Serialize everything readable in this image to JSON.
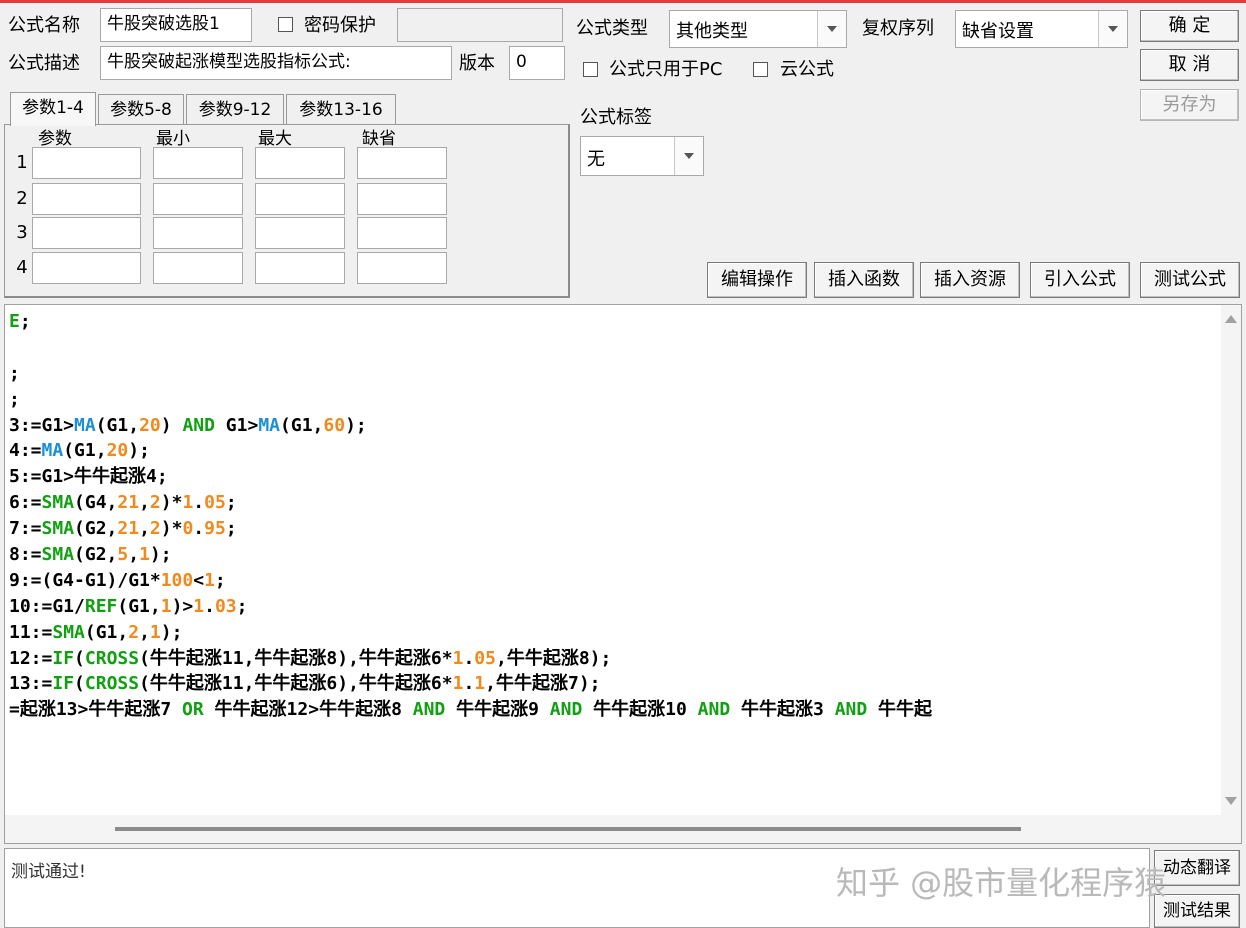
{
  "form": {
    "name_label": "公式名称",
    "name_value": "牛股突破选股1",
    "password_label": "密码保护",
    "password_value": "",
    "desc_label": "公式描述",
    "desc_value": "牛股突破起涨模型选股指标公式:",
    "version_label": "版本",
    "version_value": "0",
    "type_label": "公式类型",
    "type_value": "其他类型",
    "rights_label": "复权序列",
    "rights_value": "缺省设置",
    "pc_only_label": "公式只用于PC",
    "cloud_label": "云公式",
    "tag_label": "公式标签",
    "tag_value": "无"
  },
  "buttons": {
    "ok": "确 定",
    "cancel": "取 消",
    "save_as": "另存为",
    "edit_ops": "编辑操作",
    "insert_func": "插入函数",
    "insert_res": "插入资源",
    "import_formula": "引入公式",
    "test_formula": "测试公式",
    "dynamic_translate": "动态翻译",
    "test_result": "测试结果"
  },
  "tabs": [
    "参数1-4",
    "参数5-8",
    "参数9-12",
    "参数13-16"
  ],
  "params": {
    "headers": [
      "参数",
      "最小",
      "最大",
      "缺省"
    ],
    "rows": [
      "1",
      "2",
      "3",
      "4"
    ]
  },
  "code_lines": [
    [
      {
        "t": "E",
        "c": "fg"
      },
      {
        "t": ";"
      }
    ],
    [],
    [
      {
        "t": ";"
      }
    ],
    [
      {
        "t": ";"
      }
    ],
    [
      {
        "t": "3:=G1>"
      },
      {
        "t": "MA",
        "c": "fn"
      },
      {
        "t": "(G1,"
      },
      {
        "t": "20",
        "c": "num"
      },
      {
        "t": ") "
      },
      {
        "t": "AND",
        "c": "kw"
      },
      {
        "t": " G1>"
      },
      {
        "t": "MA",
        "c": "fn"
      },
      {
        "t": "(G1,"
      },
      {
        "t": "60",
        "c": "num"
      },
      {
        "t": ");"
      }
    ],
    [
      {
        "t": "4:="
      },
      {
        "t": "MA",
        "c": "fn"
      },
      {
        "t": "(G1,"
      },
      {
        "t": "20",
        "c": "num"
      },
      {
        "t": ");"
      }
    ],
    [
      {
        "t": "5:=G1>牛牛起涨4;"
      }
    ],
    [
      {
        "t": "6:="
      },
      {
        "t": "SMA",
        "c": "fg"
      },
      {
        "t": "(G4,"
      },
      {
        "t": "21",
        "c": "num"
      },
      {
        "t": ","
      },
      {
        "t": "2",
        "c": "num"
      },
      {
        "t": ")*"
      },
      {
        "t": "1",
        "c": "num"
      },
      {
        "t": "."
      },
      {
        "t": "05",
        "c": "num"
      },
      {
        "t": ";"
      }
    ],
    [
      {
        "t": "7:="
      },
      {
        "t": "SMA",
        "c": "fg"
      },
      {
        "t": "(G2,"
      },
      {
        "t": "21",
        "c": "num"
      },
      {
        "t": ","
      },
      {
        "t": "2",
        "c": "num"
      },
      {
        "t": ")*"
      },
      {
        "t": "0",
        "c": "num"
      },
      {
        "t": "."
      },
      {
        "t": "95",
        "c": "num"
      },
      {
        "t": ";"
      }
    ],
    [
      {
        "t": "8:="
      },
      {
        "t": "SMA",
        "c": "fg"
      },
      {
        "t": "(G2,"
      },
      {
        "t": "5",
        "c": "num"
      },
      {
        "t": ","
      },
      {
        "t": "1",
        "c": "num"
      },
      {
        "t": ");"
      }
    ],
    [
      {
        "t": "9:=(G4-G1)/G1*"
      },
      {
        "t": "100",
        "c": "num"
      },
      {
        "t": "<"
      },
      {
        "t": "1",
        "c": "num"
      },
      {
        "t": ";"
      }
    ],
    [
      {
        "t": "10:=G1/"
      },
      {
        "t": "REF",
        "c": "fg"
      },
      {
        "t": "(G1,"
      },
      {
        "t": "1",
        "c": "num"
      },
      {
        "t": ")>"
      },
      {
        "t": "1",
        "c": "num"
      },
      {
        "t": "."
      },
      {
        "t": "03",
        "c": "num"
      },
      {
        "t": ";"
      }
    ],
    [
      {
        "t": "11:="
      },
      {
        "t": "SMA",
        "c": "fg"
      },
      {
        "t": "(G1,"
      },
      {
        "t": "2",
        "c": "num"
      },
      {
        "t": ","
      },
      {
        "t": "1",
        "c": "num"
      },
      {
        "t": ");"
      }
    ],
    [
      {
        "t": "12:="
      },
      {
        "t": "IF",
        "c": "fg"
      },
      {
        "t": "("
      },
      {
        "t": "CROSS",
        "c": "fg"
      },
      {
        "t": "(牛牛起涨11,牛牛起涨8),牛牛起涨6*"
      },
      {
        "t": "1",
        "c": "num"
      },
      {
        "t": "."
      },
      {
        "t": "05",
        "c": "num"
      },
      {
        "t": ",牛牛起涨8);"
      }
    ],
    [
      {
        "t": "13:="
      },
      {
        "t": "IF",
        "c": "fg"
      },
      {
        "t": "("
      },
      {
        "t": "CROSS",
        "c": "fg"
      },
      {
        "t": "(牛牛起涨11,牛牛起涨6),牛牛起涨6*"
      },
      {
        "t": "1",
        "c": "num"
      },
      {
        "t": "."
      },
      {
        "t": "1",
        "c": "num"
      },
      {
        "t": ",牛牛起涨7);"
      }
    ],
    [
      {
        "t": "=起涨13>牛牛起涨7 "
      },
      {
        "t": "OR",
        "c": "kw"
      },
      {
        "t": " 牛牛起涨12>牛牛起涨8 "
      },
      {
        "t": "AND",
        "c": "kw"
      },
      {
        "t": " 牛牛起涨9 "
      },
      {
        "t": "AND",
        "c": "kw"
      },
      {
        "t": " 牛牛起涨10 "
      },
      {
        "t": "AND",
        "c": "kw"
      },
      {
        "t": " 牛牛起涨3 "
      },
      {
        "t": "AND",
        "c": "kw"
      },
      {
        "t": " 牛牛起"
      }
    ]
  ],
  "status_text": "测试通过!",
  "watermark": "知乎 @股市量化程序猿"
}
